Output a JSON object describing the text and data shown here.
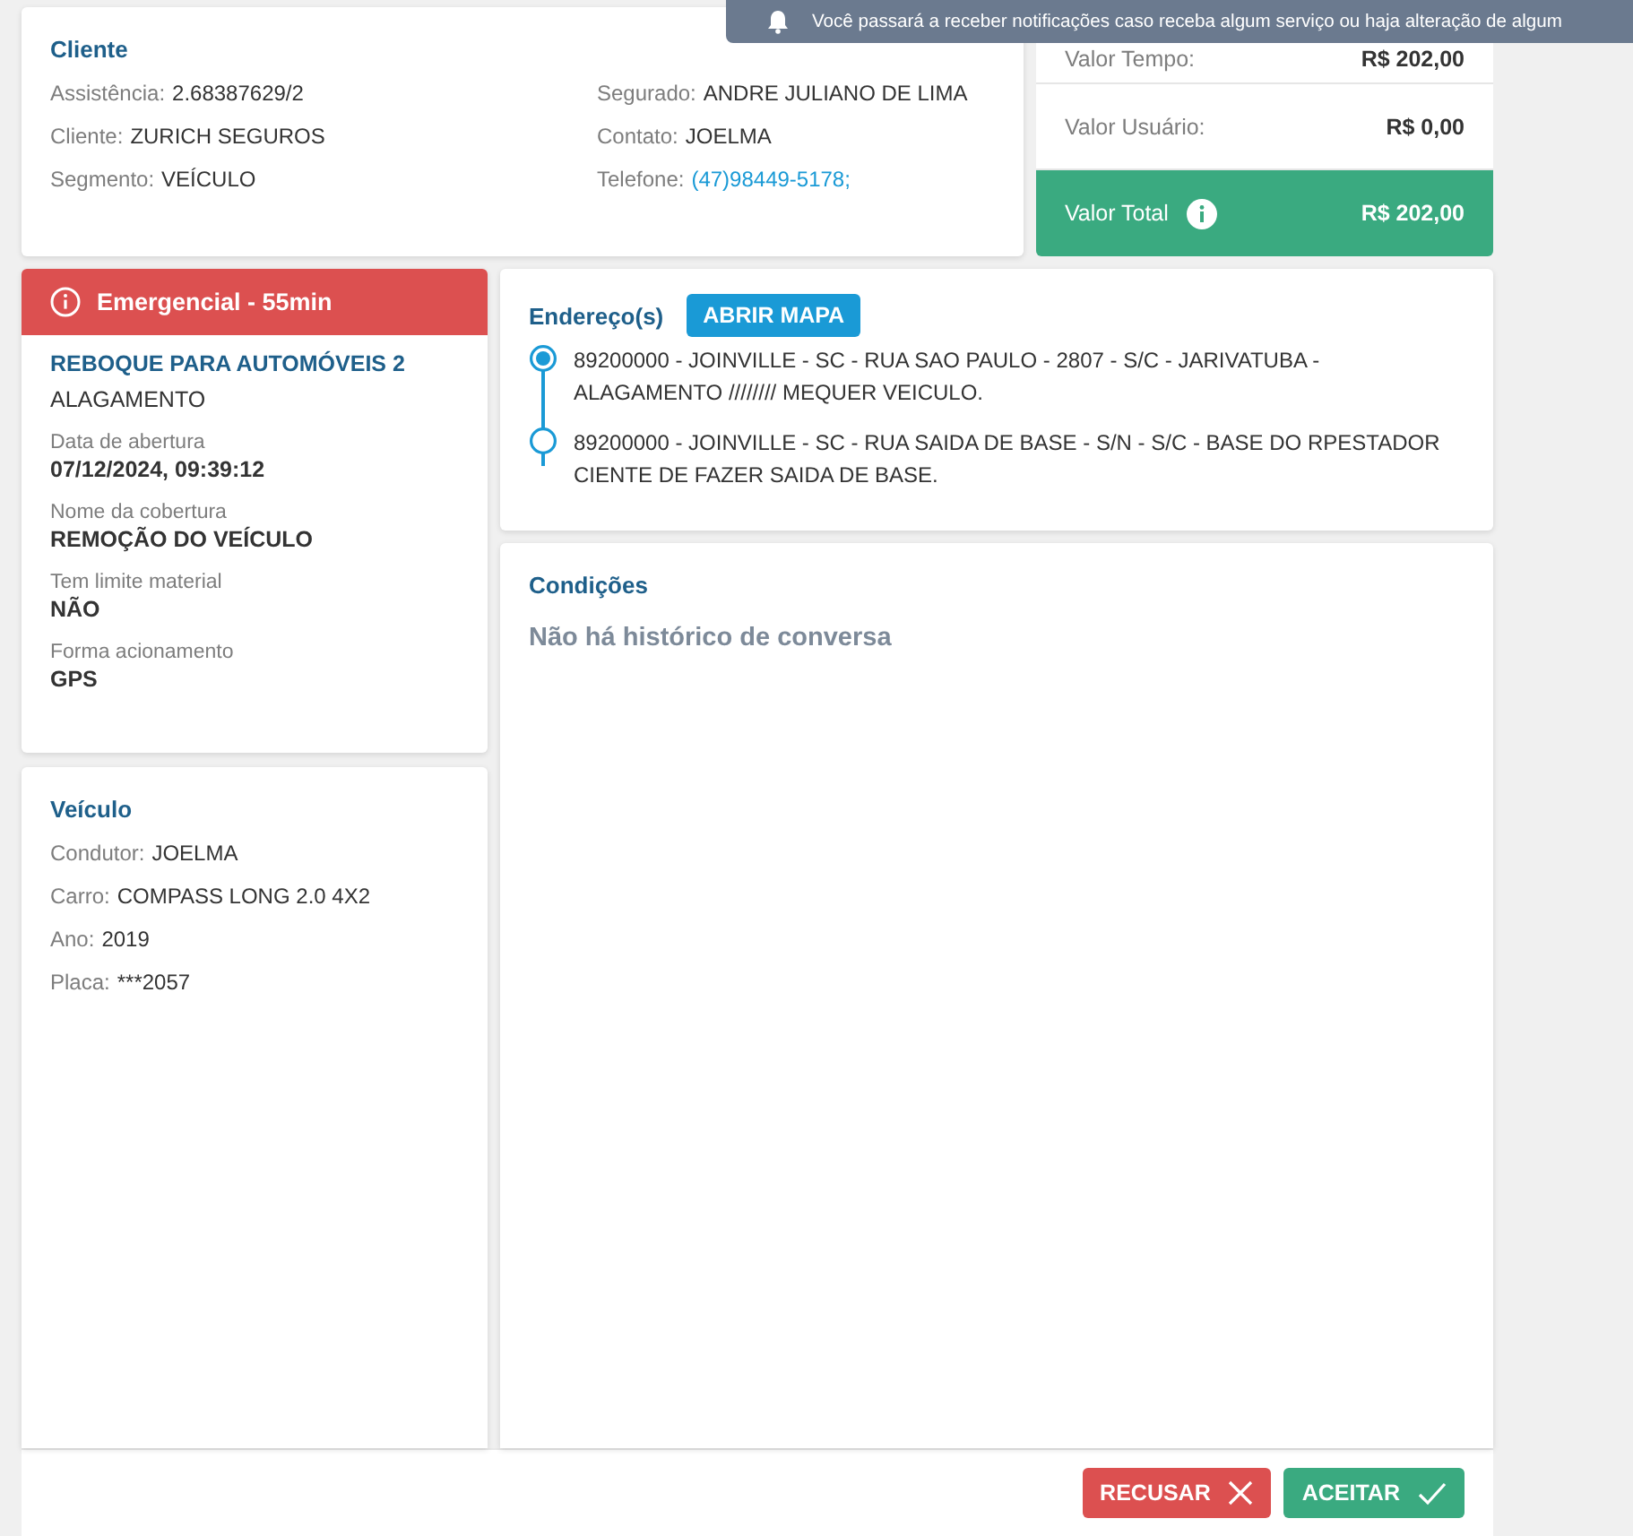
{
  "toast": {
    "text": "Você passará a receber notificações caso receba algum serviço ou haja alteração de algum"
  },
  "cliente": {
    "title": "Cliente",
    "fields": [
      {
        "label": "Assistência:",
        "value": "2.68387629/2",
        "kind": "text"
      },
      {
        "label": "Segurado:",
        "value": "ANDRE JULIANO DE LIMA",
        "kind": "text"
      },
      {
        "label": "Cliente:",
        "value": "ZURICH SEGUROS",
        "kind": "text"
      },
      {
        "label": "Contato:",
        "value": "JOELMA",
        "kind": "text"
      },
      {
        "label": "Segmento:",
        "value": "VEÍCULO",
        "kind": "text"
      },
      {
        "label": "Telefone:",
        "value": "(47)98449-5178;",
        "kind": "link"
      }
    ]
  },
  "valores": [
    {
      "label": "Valor Tempo:",
      "value": "R$ 202,00",
      "kind": "row"
    },
    {
      "label": "Valor Usuário:",
      "value": "R$ 0,00",
      "kind": "row"
    },
    {
      "label": "Valor Total",
      "value": "R$ 202,00",
      "kind": "total"
    }
  ],
  "servico": {
    "alert": "Emergencial - 55min",
    "title": "REBOQUE PARA AUTOMÓVEIS 2",
    "subtitle": "ALAGAMENTO",
    "details": [
      {
        "label": "Data de abertura",
        "value": "07/12/2024, 09:39:12"
      },
      {
        "label": "Nome da cobertura",
        "value": "REMOÇÃO DO VEÍCULO"
      },
      {
        "label": "Tem limite material",
        "value": "NÃO"
      },
      {
        "label": "Forma acionamento",
        "value": "GPS"
      }
    ]
  },
  "veiculo": {
    "title": "Veículo",
    "fields": [
      {
        "label": "Condutor:",
        "value": "JOELMA"
      },
      {
        "label": "Carro:",
        "value": "COMPASS LONG 2.0 4X2"
      },
      {
        "label": "Ano:",
        "value": "2019"
      },
      {
        "label": "Placa:",
        "value": "***2057"
      }
    ]
  },
  "enderecos": {
    "title": "Endereço(s)",
    "button": "ABRIR MAPA",
    "items": [
      {
        "text": "89200000 - JOINVILLE - SC - RUA SAO PAULO - 2807 - S/C - JARIVATUBA - ALAGAMENTO //////// MEQUER VEICULO.",
        "kind": "origin"
      },
      {
        "text": "89200000 - JOINVILLE - SC - RUA SAIDA DE BASE - S/N - S/C - BASE DO RPESTADOR CIENTE DE FAZER SAIDA DE BASE.",
        "kind": "destination"
      }
    ]
  },
  "condicoes": {
    "title": "Condições",
    "empty": "Não há histórico de conversa"
  },
  "actions": [
    {
      "label": "RECUSAR",
      "kind": "reject"
    },
    {
      "label": "ACEITAR",
      "kind": "accept"
    }
  ]
}
